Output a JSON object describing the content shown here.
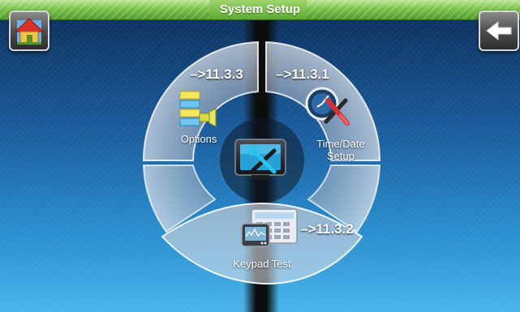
{
  "header": {
    "title": "System Setup",
    "home_icon": "home-icon",
    "back_icon": "back-arrow-icon"
  },
  "menu": {
    "center_icon": "monitor-tools-icon",
    "items": [
      {
        "label": "Options",
        "reference": "–>11.3.3",
        "icon": "options-list-icon"
      },
      {
        "label_line1": "Time/Date",
        "label_line2": "Setup",
        "reference": "–>11.3.1",
        "icon": "clock-tools-icon"
      },
      {
        "label": "Keypad Test",
        "reference": "–>11.3.2",
        "icon": "keypad-icon"
      }
    ]
  },
  "colors": {
    "titlebar": "#7bc24a",
    "background_top": "#0b2c55",
    "background_bottom": "#4ab4ea",
    "wheel_segment": "#c4ccd6"
  }
}
